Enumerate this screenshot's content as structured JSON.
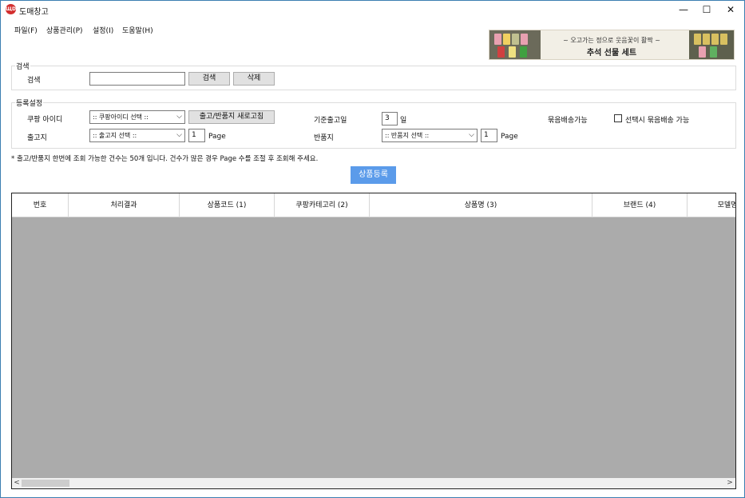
{
  "window": {
    "title": "도매창고",
    "logo_text": "ЩD",
    "minimize": "—",
    "maximize": "☐",
    "close": "✕"
  },
  "menu": [
    {
      "label": "파일(F)"
    },
    {
      "label": "상품관리(P)"
    },
    {
      "label": "설정(I)"
    },
    {
      "label": "도움말(H)"
    }
  ],
  "banner": {
    "subtitle": "~ 오고가는 정으로 웃음꽃이 활짝 ~",
    "title": "추석 선물 세트"
  },
  "search": {
    "group_label": "검색",
    "field_label": "검색",
    "input_value": "",
    "search_button": "검색",
    "delete_button": "삭제"
  },
  "register": {
    "group_label": "등록설정",
    "coupang_id_label": "쿠팡 아이디",
    "coupang_id_select": ":: 쿠팡아이디 선택 ::",
    "refresh_button": "출고/반품지 새로고침",
    "base_days_label": "기준출고일",
    "base_days_value": "3",
    "base_days_unit": "일",
    "bundle_label": "묶음배송가능",
    "bundle_checkbox_label": "선택시 묶음배송 가능",
    "bundle_checked": false,
    "shipping_label": "출고지",
    "shipping_select": ":: 출고지 선택 ::",
    "shipping_page": "1",
    "shipping_page_unit": "Page",
    "return_label": "반품지",
    "return_select": ":: 반품지 선택 ::",
    "return_page": "1",
    "return_page_unit": "Page"
  },
  "notice": "* 출고/반품지 한번에 조회 가능한 건수는 50개 입니다. 건수가 많은 경우 Page 수를 조절 후 조회해 주세요.",
  "register_button": "상품등록",
  "grid": {
    "columns": [
      "번호",
      "처리결과",
      "상품코드 (1)",
      "쿠팡카테고리 (2)",
      "상품명 (3)",
      "브랜드 (4)",
      "모델명"
    ],
    "left_arrow": "<",
    "right_arrow": ">"
  },
  "colors": {
    "accent": "#5b9bea",
    "grid_background": "#ababab",
    "window_border": "#3c7fb1"
  }
}
